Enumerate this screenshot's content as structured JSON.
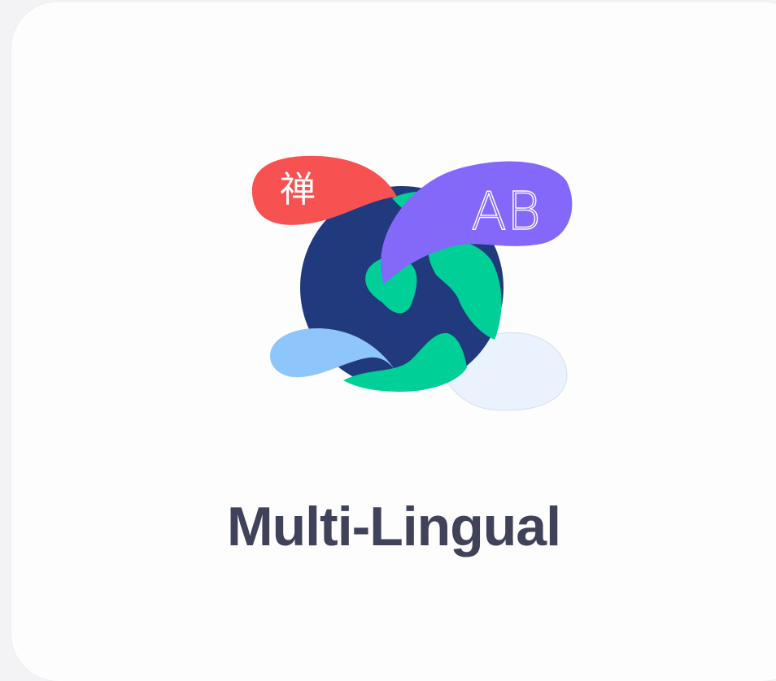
{
  "card": {
    "title": "Multi-Lingual",
    "illustration": {
      "icon": "multilingual-globe-icon",
      "bubbles": [
        {
          "name": "red-speech-bubble",
          "text": "禅"
        },
        {
          "name": "purple-speech-bubble",
          "text": "AB"
        },
        {
          "name": "light-blue-speech-bubble",
          "text": ""
        },
        {
          "name": "pale-speech-bubble",
          "text": ""
        }
      ]
    }
  },
  "colors": {
    "card_background": "#fdfdfd",
    "page_background": "#f3f3f5",
    "title_text": "#3f4258",
    "globe_ocean": "#203a7d",
    "globe_land": "#00cf98",
    "bubble_red": "#f85151",
    "bubble_purple": "#8468fa",
    "bubble_light_blue": "#8ec5fa",
    "bubble_pale": "#eaf2fd"
  }
}
